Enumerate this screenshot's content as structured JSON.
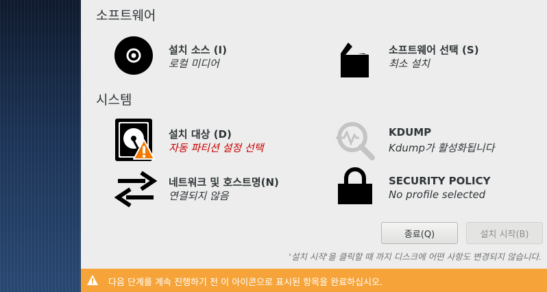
{
  "sections": {
    "software": "소프트웨어",
    "system": "시스템"
  },
  "spokes": {
    "install_source": {
      "title": "설치 소스 (I)",
      "status": "로컬 미디어"
    },
    "software_selection": {
      "title": "소프트웨어 선택 (S)",
      "status": "최소 설치"
    },
    "install_destination": {
      "title": "설치 대상 (D)",
      "status": "자동 파티션 설정 선택"
    },
    "kdump": {
      "title": "KDUMP",
      "status": "Kdump가 활성화됩니다"
    },
    "network": {
      "title": "네트워크 및 호스트명(N)",
      "status": "연결되지 않음"
    },
    "security_policy": {
      "title": "SECURITY POLICY",
      "status": "No profile selected"
    }
  },
  "buttons": {
    "quit": "종료(Q)",
    "begin_install": "설치 시작(B)"
  },
  "hint": "'설치 시작'을 클릭할 때 까지 디스크에 어떤 사항도 변경되지 않습니다.",
  "warning_bar": {
    "text": "다음 단계를 계속 진행하기 전 이 아이콘으로 표시된 항목을 완료하십시오.",
    "color": "#f6a43a"
  },
  "colors": {
    "warning_status": "#cc0000",
    "sidebar": "#1c3457",
    "background": "#ededed"
  },
  "icons": {
    "install_source": "disc-icon",
    "software_selection": "package-icon",
    "install_destination": "harddisk-icon",
    "install_destination_badge": "warning-icon",
    "kdump": "search-icon",
    "network": "network-arrows-icon",
    "security_policy": "lock-icon"
  }
}
